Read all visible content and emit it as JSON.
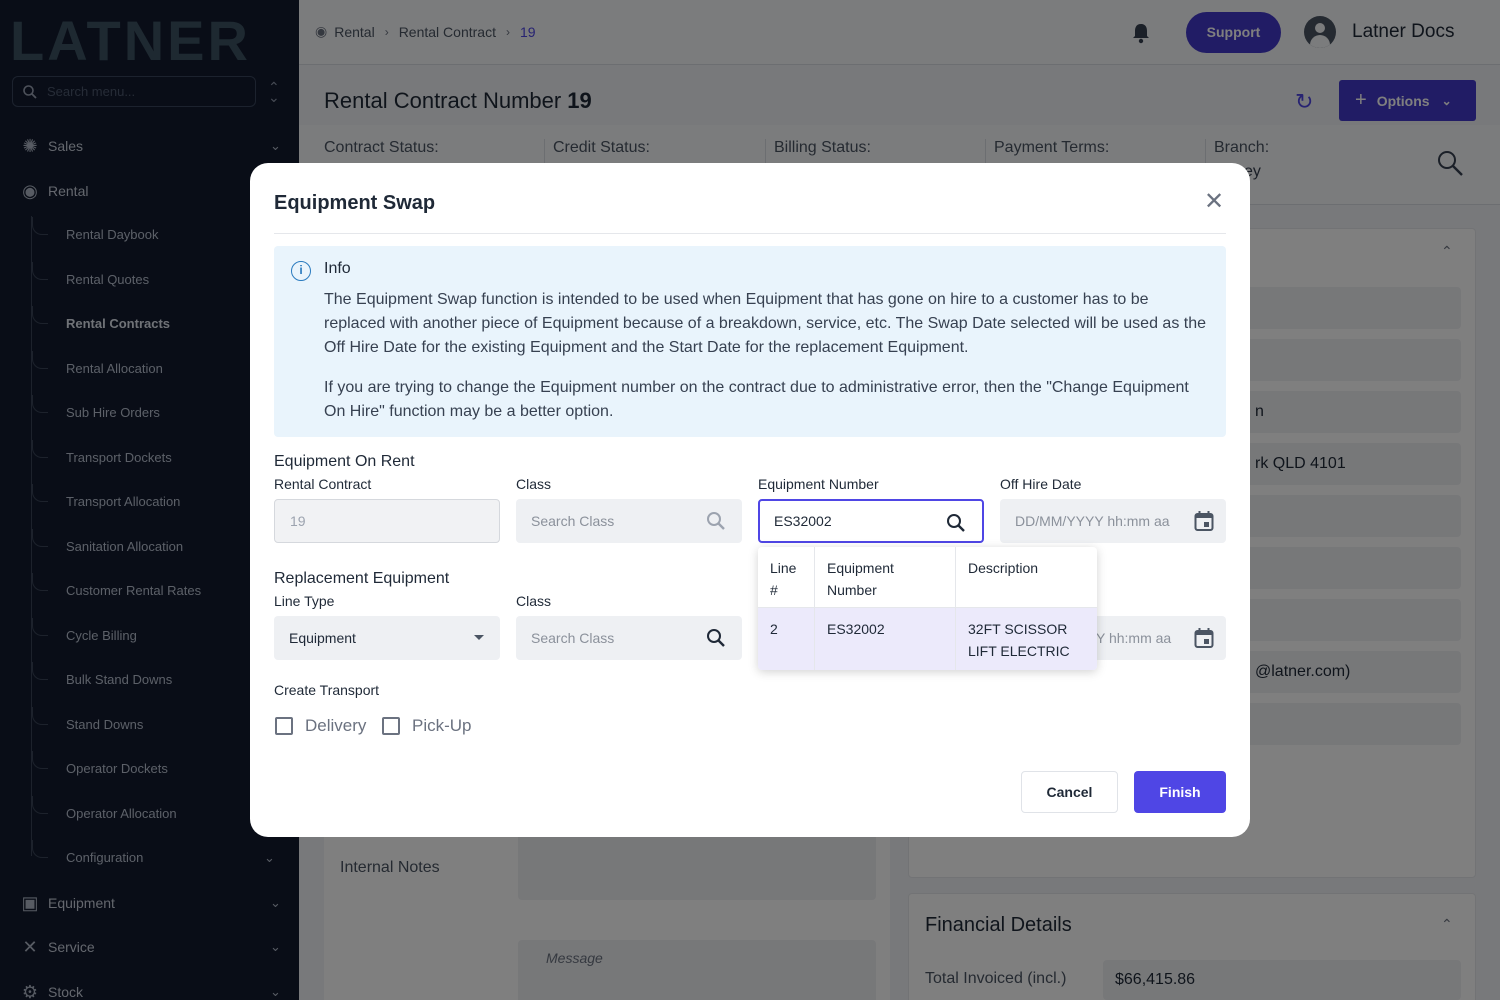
{
  "sidebar": {
    "logo": "LATNER",
    "search_placeholder": "Search menu...",
    "items_top": [
      {
        "label": "Sales",
        "icon": "gear-cog-icon"
      },
      {
        "label": "Rental",
        "icon": "palette-icon"
      }
    ],
    "rental_subitems": [
      "Rental Daybook",
      "Rental Quotes",
      "Rental Contracts",
      "Rental Allocation",
      "Sub Hire Orders",
      "Transport Dockets",
      "Transport Allocation",
      "Sanitation Allocation",
      "Customer Rental Rates",
      "Cycle Billing",
      "Bulk Stand Downs",
      "Stand Downs",
      "Operator Dockets",
      "Operator Allocation",
      "Configuration"
    ],
    "active_subitem": "Rental Contracts",
    "items_bottom": [
      {
        "label": "Equipment",
        "icon": "clipboard-icon"
      },
      {
        "label": "Service",
        "icon": "tools-icon"
      },
      {
        "label": "Stock",
        "icon": "gears-icon"
      }
    ]
  },
  "header": {
    "breadcrumb": [
      "Rental",
      "Rental Contract",
      "19"
    ],
    "support_label": "Support",
    "user_name": "Latner Docs"
  },
  "page": {
    "title": "Rental Contract Number",
    "contract_number": "19",
    "options_label": "Options",
    "status_labels": [
      "Contract Status:",
      "Credit Status:",
      "Billing Status:",
      "Payment Terms:",
      "Branch:"
    ],
    "branch_value_partial": "ey",
    "right_card_values": [
      "",
      "",
      "n",
      "rk QLD 4101",
      "",
      "",
      "",
      "@latner.com)",
      ""
    ],
    "internal_notes_label": "Internal Notes",
    "message_placeholder": "Message",
    "financial_title": "Financial Details",
    "total_invoiced_label": "Total Invoiced (incl.)",
    "total_invoiced_value": "$66,415.86"
  },
  "modal": {
    "title": "Equipment Swap",
    "info_title": "Info",
    "info_p1": "The Equipment Swap function is intended to be used when Equipment that has gone on hire to a customer has to be replaced with another piece of Equipment because of a breakdown, service, etc. The Swap Date selected will be used as the Off Hire Date for the existing Equipment and the Start Date for the replacement Equipment.",
    "info_p2": "If you are trying to change the Equipment number on the contract due to administrative error, then the \"Change Equipment On Hire\" function may be a better option.",
    "on_rent_heading": "Equipment On Rent",
    "rental_contract_label": "Rental Contract",
    "rental_contract_value": "19",
    "class_label": "Class",
    "class_placeholder": "Search Class",
    "equipment_number_label": "Equipment Number",
    "equipment_number_value": "ES32002",
    "off_hire_label": "Off Hire Date",
    "date_placeholder": "DD/MM/YYYY hh:mm aa",
    "date_placeholder_partial": "Y hh:mm aa",
    "replacement_heading": "Replacement Equipment",
    "line_type_label": "Line Type",
    "line_type_value": "Equipment",
    "create_transport_label": "Create Transport",
    "delivery_label": "Delivery",
    "pickup_label": "Pick-Up",
    "cancel_label": "Cancel",
    "finish_label": "Finish",
    "dropdown": {
      "headers": [
        "Line #",
        "Equipment Number",
        "Description"
      ],
      "rows": [
        [
          "2",
          "ES32002",
          "32FT SCISSOR LIFT ELECTRIC"
        ]
      ]
    }
  },
  "colors": {
    "accent": "#4f46e5",
    "sidebar_bg": "#121b2e",
    "info_bg": "#e9f4fc"
  }
}
